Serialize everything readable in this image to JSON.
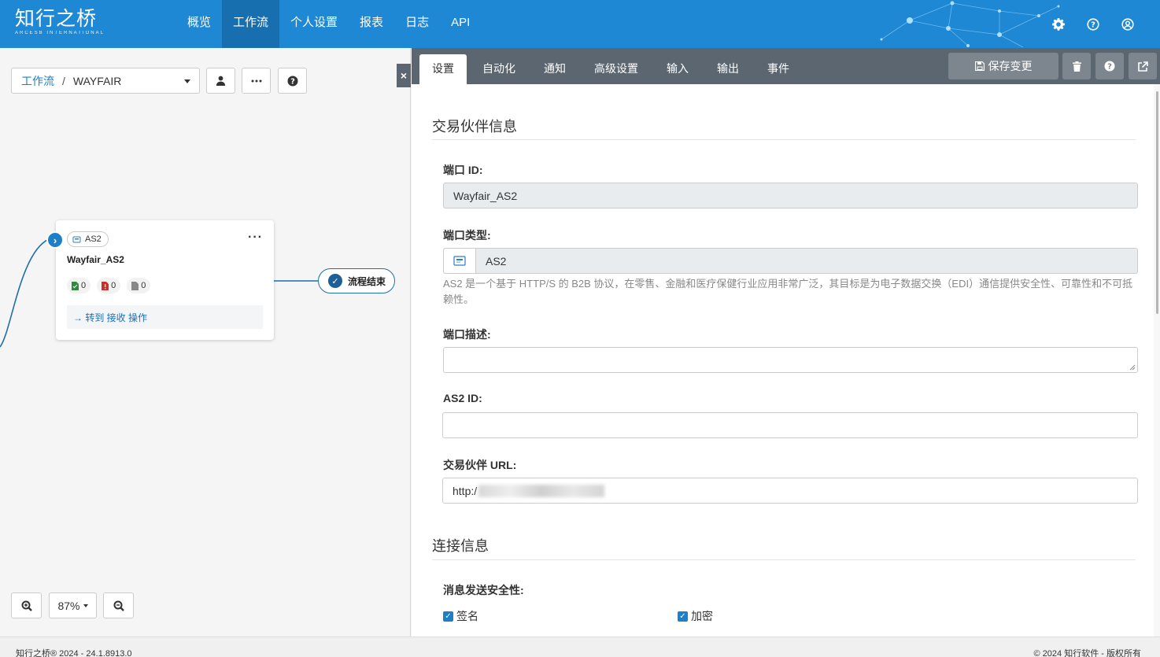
{
  "header": {
    "logo_main": "知行之桥",
    "logo_sub": "ARCESB INTERNATIONAL",
    "nav": [
      "概览",
      "工作流",
      "个人设置",
      "报表",
      "日志",
      "API"
    ],
    "active_nav": "工作流"
  },
  "workflow": {
    "breadcrumb_root": "工作流",
    "breadcrumb_sep": "/",
    "current": "WAYFAIR"
  },
  "node": {
    "chip": "AS2",
    "title": "Wayfair_AS2",
    "counts": {
      "success": "0",
      "error": "0",
      "pending": "0"
    },
    "action": "→ 转到 接收 操作"
  },
  "end_node": {
    "label": "流程结束"
  },
  "zoom": {
    "level": "87%"
  },
  "tabs": [
    "设置",
    "自动化",
    "通知",
    "高级设置",
    "输入",
    "输出",
    "事件"
  ],
  "toolbar": {
    "save_label": "保存变更"
  },
  "form": {
    "section1": "交易伙伴信息",
    "port_id_label": "端口 ID:",
    "port_id_value": "Wayfair_AS2",
    "port_type_label": "端口类型:",
    "port_type_value": "AS2",
    "port_type_help": "AS2 是一个基于 HTTP/S 的 B2B 协议，在零售、金融和医疗保健行业应用非常广泛，其目标是为电子数据交换（EDI）通信提供安全性、可靠性和不可抵赖性。",
    "desc_label": "端口描述:",
    "desc_value": "",
    "as2id_label": "AS2 ID:",
    "as2id_value": "",
    "url_label": "交易伙伴 URL:",
    "url_value": "http:/",
    "section2": "连接信息",
    "security_label": "消息发送安全性:",
    "sign_label": "签名",
    "encrypt_label": "加密"
  },
  "footer": {
    "left": "知行之桥® 2024 - 24.1.8913.0",
    "right": "© 2024 知行软件 - 版权所有"
  },
  "colors": {
    "brand": "#1e88d4",
    "tabbar": "#5c6670",
    "accent": "#1e7fc8"
  }
}
